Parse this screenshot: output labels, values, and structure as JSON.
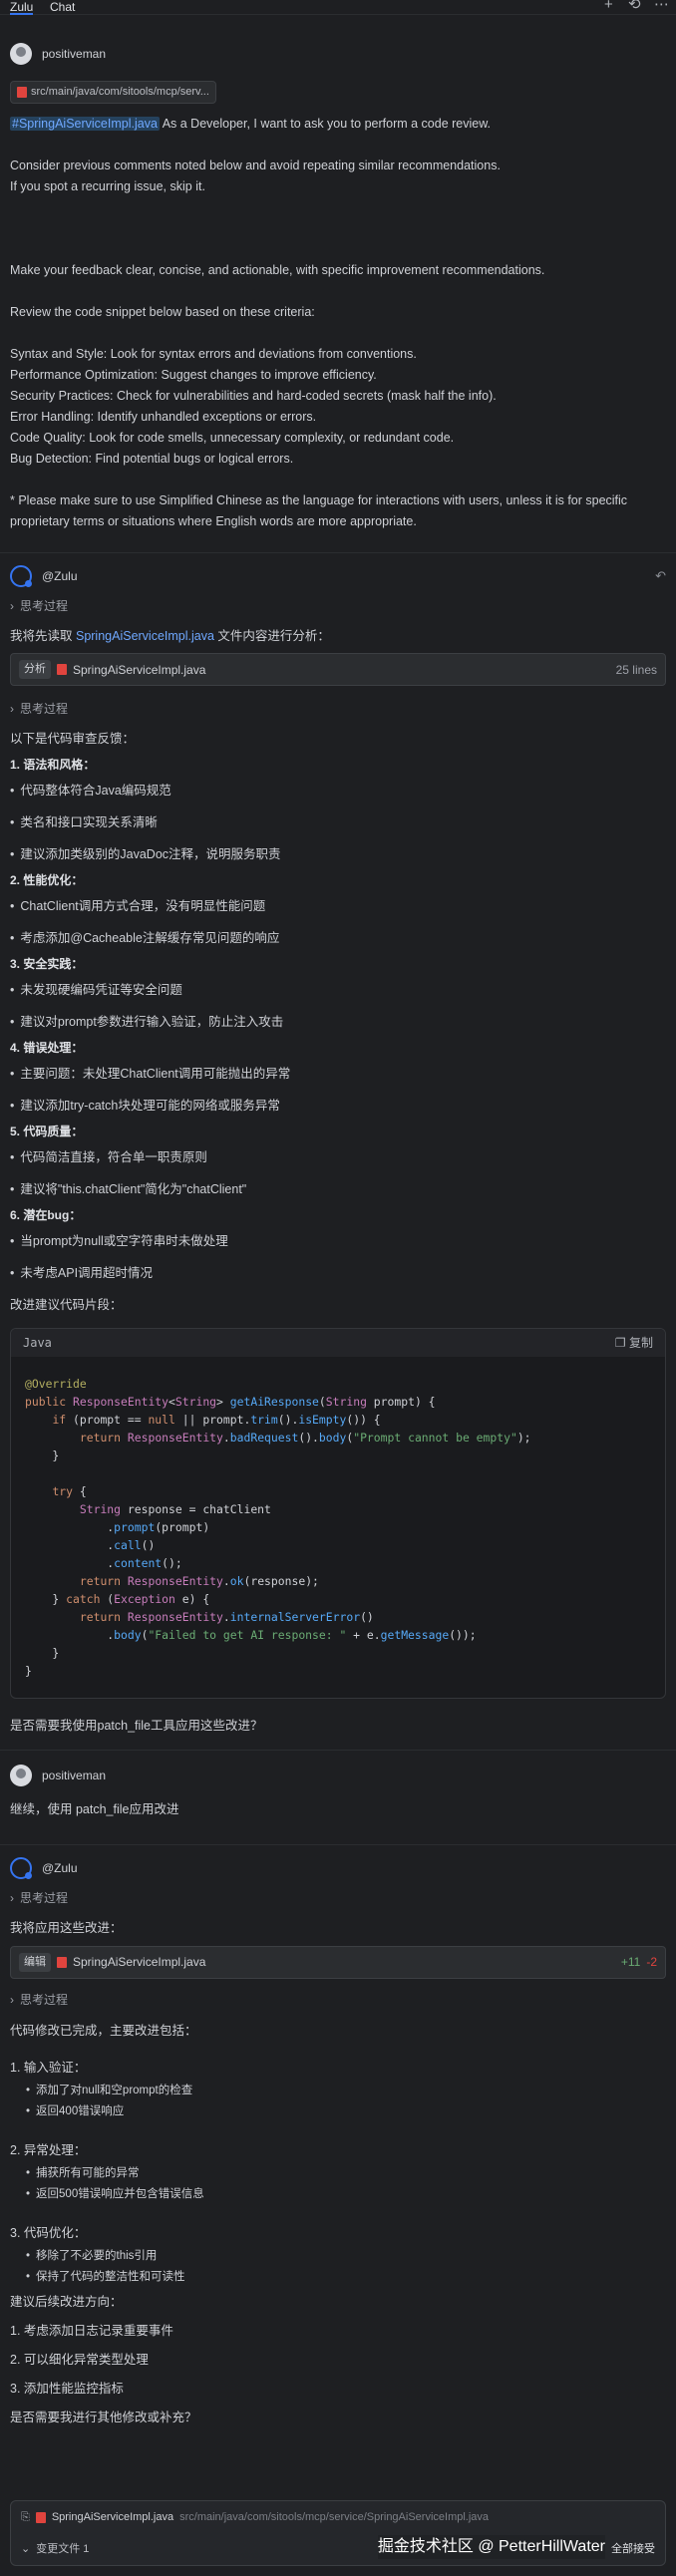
{
  "topbar": {
    "tabs": [
      "Zulu",
      "Chat"
    ]
  },
  "user_name": "positiveman",
  "prompt": {
    "file_path": "src/main/java/com/sitools/mcp/serv...",
    "file_tag": "#SpringAiServiceImpl.java",
    "intro": " As a Developer, I want to ask you to perform a code review.",
    "line2": "Consider previous comments noted below and avoid repeating similar recommendations.",
    "line3": "If you spot a recurring issue, skip it.",
    "line4": "Make your feedback clear, concise, and actionable, with specific improvement recommendations.",
    "line5": "Review the code snippet below based on these criteria:",
    "criteria": [
      "Syntax and Style: Look for syntax errors and deviations from conventions.",
      "Performance Optimization: Suggest changes to improve efficiency.",
      "Security Practices: Check for vulnerabilities and hard-coded secrets (mask half the info).",
      "Error Handling: Identify unhandled exceptions or errors.",
      "Code Quality: Look for code smells, unnecessary complexity, or redundant code.",
      "Bug Detection: Find potential bugs or logical errors."
    ],
    "note": "* Please make sure to use Simplified Chinese as the language for interactions with users, unless it is for specific proprietary terms or situations where English words are more appropriate."
  },
  "zulu": {
    "name": "@Zulu",
    "thinking": "思考过程",
    "read_prefix": "我将先读取 ",
    "read_file": "SpringAiServiceImpl.java",
    "read_suffix": " 文件内容进行分析：",
    "analyze_tag": "分析",
    "analyze_file": "SpringAiServiceImpl.java",
    "analyze_lines": "25 lines",
    "review_title": "以下是代码审查反馈：",
    "sections": [
      {
        "title": "1. 语法和风格：",
        "items": [
          "代码整体符合Java编码规范",
          "类名和接口实现关系清晰",
          "建议添加类级别的JavaDoc注释，说明服务职责"
        ]
      },
      {
        "title": "2. 性能优化：",
        "items": [
          "ChatClient调用方式合理，没有明显性能问题",
          "考虑添加@Cacheable注解缓存常见问题的响应"
        ]
      },
      {
        "title": "3. 安全实践：",
        "items": [
          "未发现硬编码凭证等安全问题",
          "建议对prompt参数进行输入验证，防止注入攻击"
        ]
      },
      {
        "title": "4. 错误处理：",
        "items": [
          "主要问题：未处理ChatClient调用可能抛出的异常",
          "建议添加try-catch块处理可能的网络或服务异常"
        ]
      },
      {
        "title": "5. 代码质量：",
        "items": [
          "代码简洁直接，符合单一职责原则",
          "建议将\"this.chatClient\"简化为\"chatClient\""
        ]
      },
      {
        "title": "6. 潜在bug：",
        "items": [
          "当prompt为null或空字符串时未做处理",
          "未考虑API调用超时情况"
        ]
      }
    ],
    "suggest_title": "改进建议代码片段：",
    "code_lang": "Java",
    "copy_label": "复制",
    "ask_patch": "是否需要我使用patch_file工具应用这些改进？"
  },
  "user_reply": "继续，使用 patch_file应用改进",
  "zulu2": {
    "applying": "我将应用这些改进：",
    "edit_tag": "编辑",
    "edit_file": "SpringAiServiceImpl.java",
    "added": "+11",
    "removed": "-2",
    "done": "代码修改已完成，主要改进包括：",
    "groups": [
      {
        "title": "1. 输入验证：",
        "items": [
          "添加了对null和空prompt的检查",
          "返回400错误响应"
        ]
      },
      {
        "title": "2. 异常处理：",
        "items": [
          "捕获所有可能的异常",
          "返回500错误响应并包含错误信息"
        ]
      },
      {
        "title": "3. 代码优化：",
        "items": [
          "移除了不必要的this引用",
          "保持了代码的整洁性和可读性"
        ]
      }
    ],
    "future_title": "建议后续改进方向：",
    "future": [
      "1. 考虑添加日志记录重要事件",
      "2. 可以细化异常类型处理",
      "3. 添加性能监控指标"
    ],
    "ask_more": "是否需要我进行其他修改或补充？"
  },
  "footer": {
    "file": "SpringAiServiceImpl.java",
    "path": "src/main/java/com/sitools/mcp/service/SpringAiServiceImpl.java",
    "changed_files": "变更文件 1",
    "watermark": "掘金技术社区 @ PetterHillWater",
    "accept_all": "全部接受"
  },
  "colors": {
    "accent": "#3574f0",
    "bg": "#1e1f22",
    "file_red": "#e0443e",
    "green": "#6aab73"
  }
}
